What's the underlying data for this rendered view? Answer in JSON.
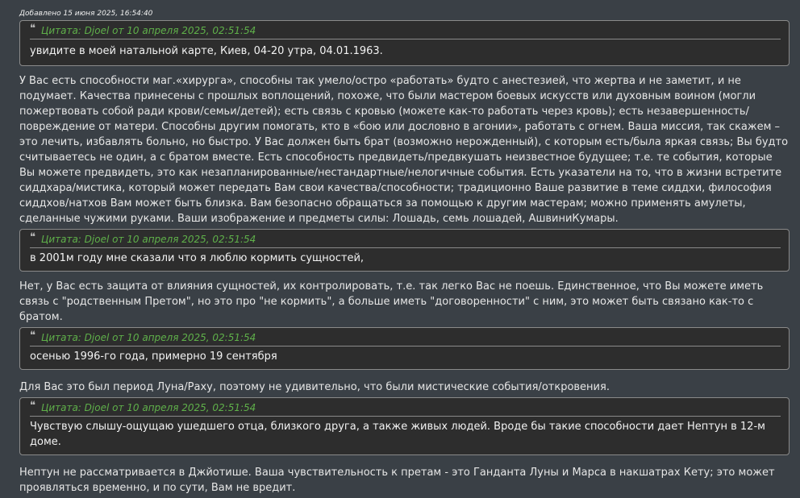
{
  "post": {
    "date": "Добавлено 15 июня 2025, 16:54:40",
    "quote_icon": "quote-icon",
    "blocks": [
      {
        "quote_header": "Цитата: Djoel от 10 апреля 2025, 02:51:54",
        "quote_text": "увидите в моей натальной карте, Киев, 04-20 утра, 04.01.1963.",
        "reply": "У Вас есть способности маг.«хирурга», способны так умело/остро «работать» будто с анестезией, что жертва и не заметит, и не подумает. Качества принесены с прошлых воплощений, похоже, что были мастером боевых искусств или духовным воином (могли пожертвовать собой ради крови/семьи/детей); есть связь с кровью (можете как-то работать через кровь); есть незавершенность/повреждение от матери. Способны другим помогать, кто в «бою или дословно в агонии», работать с огнем. Ваша миссия, так скажем – это лечить, избавлять больно, но быстро. У Вас должен быть брат (возможно нерожденный), с которым есть/была яркая связь; Вы будто считываетесь не один, а с братом вместе. Есть способность предвидеть/предвкушать неизвестное будущее; т.е. те события, которые Вы можете предвидеть, это как незапланированные/нестандартные/нелогичные события. Есть указатели на то, что в жизни встретите сиддхара/мистика, который может передать Вам свои качества/способности; традиционно Ваше развитие в теме сиддхи, философия сиддхов/натхов Вам может быть близка. Вам безопасно обращаться за помощью к другим мастерам; можно применять амулеты, сделанные чужими руками. Ваши изображение и предметы силы: Лошадь, семь лошадей, АшвиниКумары."
      },
      {
        "quote_header": "Цитата: Djoel от 10 апреля 2025, 02:51:54",
        "quote_text": "в 2001м году мне сказали что я люблю кормить сущностей,",
        "reply": "Нет, у Вас есть защита от влияния сущностей, их контролировать, т.е. так легко Вас не поешь. Единственное, что Вы можете иметь связь с \"родственным Претом\", но это про \"не кормить\", а больше иметь \"договоренности\" с ним, это может быть связано как-то с братом."
      },
      {
        "quote_header": "Цитата: Djoel от 10 апреля 2025, 02:51:54",
        "quote_text": "осенью 1996-го года, примерно 19 сентября",
        "reply": "Для Вас это был период Луна/Раху, поэтому не удивительно, что были мистические события/откровения."
      },
      {
        "quote_header": "Цитата: Djoel от 10 апреля 2025, 02:51:54",
        "quote_text": "Чувствую слышу-ощущаю ушедшего отца, близкого друга, а также живых людей. Вроде бы такие способности дает Нептун в 12-м доме.",
        "reply": "Нептун не рассматривается в Джйотише. Ваша чувствительность к претам - это Ганданта Луны и Марса в накшатрах Кету; это может проявляться временно, и по сути, Вам не вредит."
      }
    ]
  }
}
